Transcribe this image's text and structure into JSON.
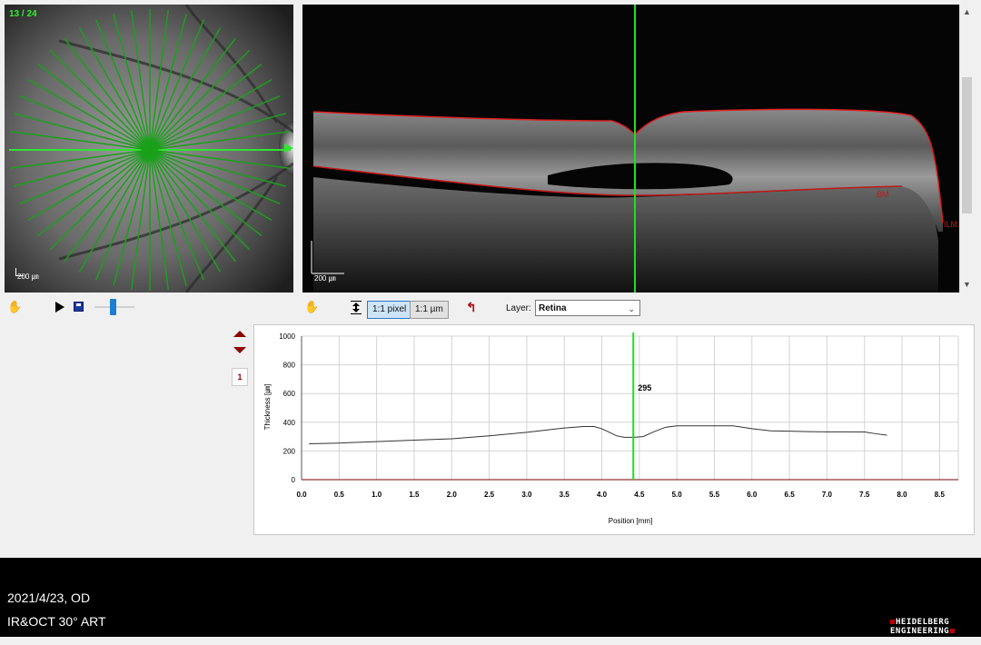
{
  "fundus": {
    "counter": "13 / 24",
    "scale_label": "200 ㎛",
    "line_count": 24,
    "line_color": "#1aa01a",
    "selected_line_color": "#2ee62e"
  },
  "oct": {
    "scale_label": "200 ㎛",
    "layer_labels": {
      "bm": "BM",
      "ilm": "ILM"
    },
    "boundary_color": "#e02020",
    "cursor_color": "#22dd22"
  },
  "toolbar": {
    "play_icon": "play-icon",
    "save_icon": "save-icon",
    "pan_icon": "hand-icon",
    "fit_icon": "fit-height-icon",
    "btn_pixel": "1:1 pixel",
    "btn_um": "1:1 µm",
    "layer_label": "Layer:",
    "layer_value": "Retina"
  },
  "side_controls": {
    "index_badge": "1"
  },
  "chart_data": {
    "type": "line",
    "title": "",
    "xlabel": "Position [mm]",
    "ylabel": "Thickness [㎛]",
    "xlim": [
      0,
      8.75
    ],
    "ylim": [
      0,
      1000
    ],
    "x_ticks": [
      "0.0",
      "0.5",
      "1.0",
      "1.5",
      "2.0",
      "2.5",
      "3.0",
      "3.5",
      "4.0",
      "4.5",
      "5.0",
      "5.5",
      "6.0",
      "6.5",
      "7.0",
      "7.5",
      "8.0",
      "8.5"
    ],
    "y_ticks": [
      "0",
      "200",
      "400",
      "600",
      "800",
      "1000"
    ],
    "grid": true,
    "cursor_x": 4.42,
    "cursor_value": "295",
    "series": [
      {
        "x": [
          0.1,
          0.5,
          1.0,
          1.5,
          2.0,
          2.5,
          3.0,
          3.25,
          3.5,
          3.75,
          3.9,
          4.0,
          4.1,
          4.2,
          4.3,
          4.42,
          4.55,
          4.7,
          4.85,
          5.0,
          5.25,
          5.5,
          5.75,
          6.0,
          6.25,
          6.5,
          6.75,
          7.0,
          7.25,
          7.5,
          7.65,
          7.8
        ],
        "y": [
          250,
          255,
          265,
          275,
          285,
          305,
          330,
          345,
          360,
          370,
          370,
          355,
          330,
          305,
          295,
          295,
          300,
          335,
          365,
          375,
          375,
          375,
          375,
          355,
          340,
          338,
          335,
          333,
          333,
          332,
          320,
          310
        ]
      }
    ]
  },
  "footer": {
    "date_eye": "2021/4/23, OD",
    "modality": "IR&OCT 30° ART",
    "logo_line1": "HEIDELBERG",
    "logo_line2": "ENGINEERING"
  }
}
